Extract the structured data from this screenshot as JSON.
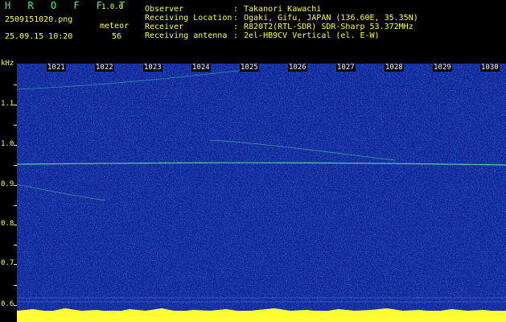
{
  "header": {
    "brand": "H R O F F T",
    "version": "1.0.0",
    "filename": "2509151020.png",
    "datetime": "25.09.15 10:20",
    "mode": "meteor",
    "count": "56",
    "rows": [
      {
        "label": "Observer",
        "value": "Takanori Kawachi"
      },
      {
        "label": "Receiving Location",
        "value": "Ogaki, Gifu, JAPAN (136.60E, 35.35N)"
      },
      {
        "label": "Receiver",
        "value": "R820T2(RTL-SDR) SDR-Sharp 53.372MHz"
      },
      {
        "label": "Receiving antenna",
        "value": "2el-HB9CV Vertical (el. E-W)"
      }
    ]
  },
  "axis": {
    "unit": "kHz",
    "time_labels": [
      "1021",
      "1022",
      "1023",
      "1024",
      "1025",
      "1026",
      "1027",
      "1028",
      "1029",
      "1030"
    ],
    "freq_labels": [
      "1.1",
      "1.0",
      "0.9",
      "0.8",
      "0.7",
      "0.6"
    ]
  },
  "colors": {
    "background": "#000000",
    "label": "#ffff33",
    "brand": "#33ff66",
    "plot": "#12209a"
  }
}
